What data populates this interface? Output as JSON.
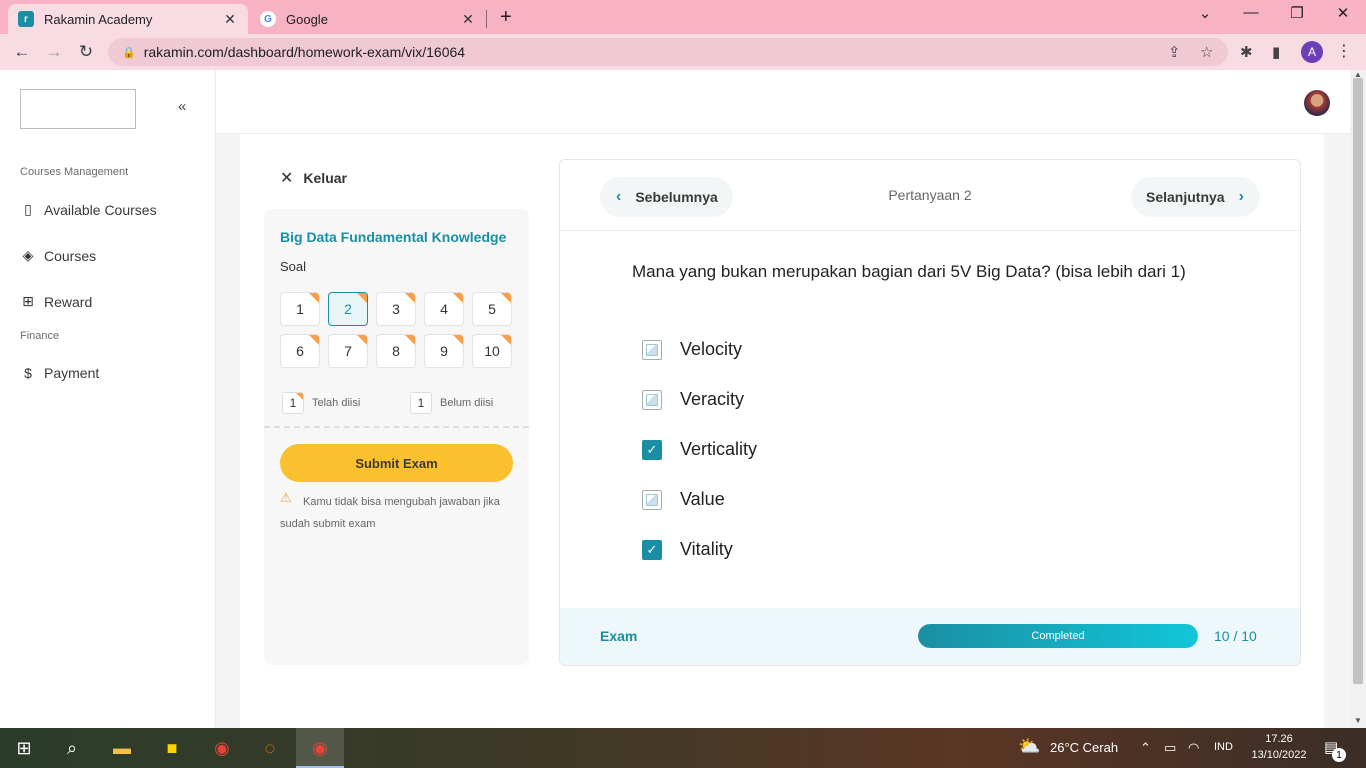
{
  "browser": {
    "tabs": [
      {
        "label": "Rakamin Academy",
        "favicon": "rakamin-icon",
        "active": true
      },
      {
        "label": "Google",
        "favicon": "google-icon",
        "active": false
      }
    ],
    "url": "rakamin.com/dashboard/homework-exam/vix/16064",
    "profile_initial": "A"
  },
  "sidebar": {
    "sections": [
      {
        "title": "Courses Management",
        "items": [
          {
            "label": "Available Courses",
            "icon": "book-icon"
          },
          {
            "label": "Courses",
            "icon": "graduation-cap-icon"
          },
          {
            "label": "Reward",
            "icon": "gift-icon"
          }
        ]
      },
      {
        "title": "Finance",
        "items": [
          {
            "label": "Payment",
            "icon": "dollar-icon"
          }
        ]
      }
    ]
  },
  "exam": {
    "exit_label": "Keluar",
    "course_title": "Big Data Fundamental Knowledge",
    "soal_label": "Soal",
    "questions": [
      "1",
      "2",
      "3",
      "4",
      "5",
      "6",
      "7",
      "8",
      "9",
      "10"
    ],
    "current_question": "2",
    "legend": {
      "answered_count": "1",
      "answered_label": "Telah diisi",
      "unanswered_count": "1",
      "unanswered_label": "Belum diisi"
    },
    "submit_label": "Submit Exam",
    "warning": "Kamu tidak bisa mengubah jawaban jika sudah submit exam"
  },
  "question_card": {
    "prev_label": "Sebelumnya",
    "next_label": "Selanjutnya",
    "question_number": "Pertanyaan 2",
    "question_text": "Mana yang bukan merupakan bagian dari 5V Big Data? (bisa lebih dari 1)",
    "options": [
      {
        "label": "Velocity",
        "checked": false
      },
      {
        "label": "Veracity",
        "checked": false
      },
      {
        "label": "Verticality",
        "checked": true
      },
      {
        "label": "Value",
        "checked": false
      },
      {
        "label": "Vitality",
        "checked": true
      }
    ],
    "footer": {
      "exam_label": "Exam",
      "progress_status": "Completed",
      "progress_fraction": 1.0,
      "progress_count": "10 / 10"
    }
  },
  "taskbar": {
    "weather": "26°C  Cerah",
    "language": "IND",
    "time": "17.26",
    "date": "13/10/2022",
    "notification_count": "1"
  },
  "colors": {
    "accent": "#1a8fa3",
    "submit": "#fbc02d",
    "badge_corner": "#f5a14a",
    "tab_bar": "#f7b3c4"
  }
}
